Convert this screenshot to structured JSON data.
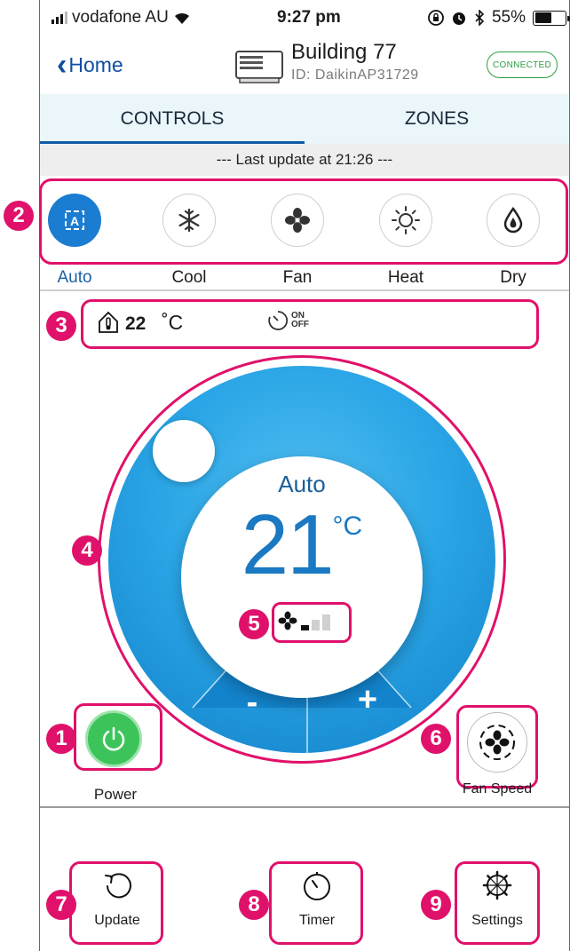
{
  "status_bar": {
    "carrier": "vodafone AU",
    "time": "9:27 pm",
    "battery": "55%",
    "battery_level": 0.55
  },
  "nav": {
    "back_label": "Home",
    "building_name": "Building 77",
    "device_id": "ID: DaikinAP31729",
    "connection_status": "CONNECTED"
  },
  "tabs": [
    {
      "label": "CONTROLS",
      "active": true
    },
    {
      "label": "ZONES",
      "active": false
    }
  ],
  "last_update": "--- Last update at 21:26 ---",
  "modes": [
    {
      "label": "Auto",
      "icon": "auto-mode-icon",
      "active": true
    },
    {
      "label": "Cool",
      "icon": "snowflake-icon",
      "active": false
    },
    {
      "label": "Fan",
      "icon": "fan-icon",
      "active": false
    },
    {
      "label": "Heat",
      "icon": "sun-icon",
      "active": false
    },
    {
      "label": "Dry",
      "icon": "droplet-icon",
      "active": false
    }
  ],
  "indoor": {
    "temperature": "22",
    "unit": "˚C",
    "timer_on": "ON",
    "timer_off": "OFF"
  },
  "dial": {
    "mode": "Auto",
    "setpoint": "21",
    "unit": "°C",
    "fan_level": 1,
    "fan_levels_total": 3,
    "minus": "-",
    "plus": "+"
  },
  "badges": [
    "1",
    "2",
    "3",
    "4",
    "5",
    "6",
    "7",
    "8",
    "9"
  ],
  "buttons": {
    "power": "Power",
    "fan_speed": "Fan Speed",
    "update": "Update",
    "timer": "Timer",
    "settings": "Settings"
  },
  "colors": {
    "accent_blue": "#1b7dd1",
    "annotation_pink": "#e0116a",
    "power_green": "#3cc45a",
    "connected_green": "#2f9e44"
  }
}
